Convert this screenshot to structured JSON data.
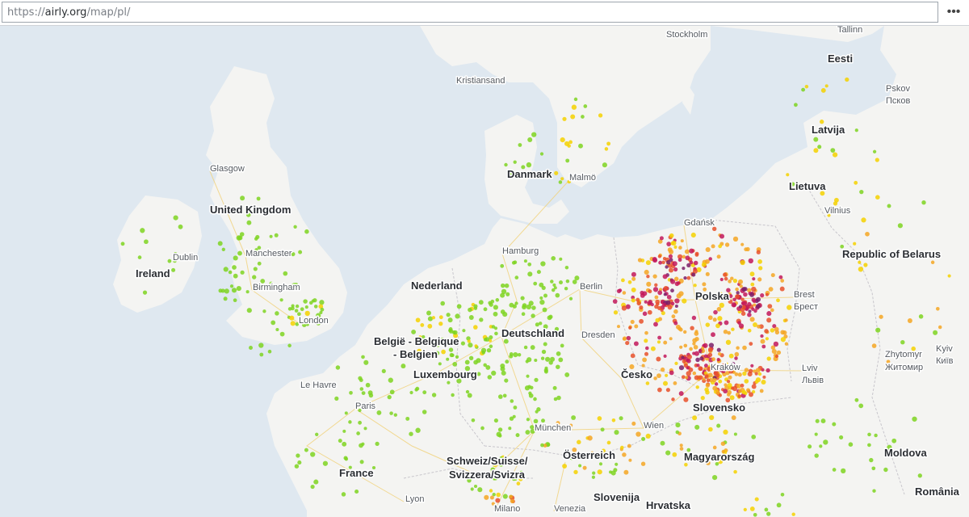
{
  "browser": {
    "url_prefix": "https://",
    "url_host": "airly.org",
    "url_path": "/map/pl/",
    "menu_icon": "more-horizontal-icon",
    "menu_glyph": "•••"
  },
  "map": {
    "colors": {
      "water": "#dfe8f0",
      "land": "#f4f4f2",
      "land_alt": "#f7f7f5",
      "borders": "#c8c6cc",
      "roads": "#f1d27a",
      "sensor_good": "#7ed321",
      "sensor_moderate": "#f5d100",
      "sensor_poor": "#f5a623",
      "sensor_bad": "#e8502a",
      "sensor_very_bad": "#c2185b",
      "sensor_extreme": "#7b1f6a"
    },
    "countries": [
      "Eesti",
      "Latvija",
      "Lietuva",
      "Danmark",
      "United Kingdom",
      "Ireland",
      "Nederland",
      "België - Belgique",
      "- Belgien",
      "Luxembourg",
      "Deutschland",
      "Polska",
      "Republic of Belarus",
      "Česko",
      "Slovensko",
      "Österreich",
      "Schweiz/Suisse/",
      "Svizzera/Svizra",
      "Magyarország",
      "France",
      "Slovenija",
      "Hrvatska",
      "Moldova",
      "România"
    ],
    "cities": [
      "Stockholm",
      "Tallinn",
      "Kristiansand",
      "Pskov",
      "Псков",
      "Malmö",
      "Glasgow",
      "Gdańsk",
      "Vilnius",
      "Dublin",
      "Manchester",
      "Hamburg",
      "Birmingham",
      "Berlin",
      "Brest",
      "Брест",
      "London",
      "Dresden",
      "Zhytomyr",
      "Житомир",
      "Kyiv",
      "Київ",
      "Kraków",
      "Lviv",
      "Львів",
      "Le Havre",
      "Paris",
      "Wien",
      "München",
      "Lyon",
      "Milano",
      "Venezia"
    ]
  }
}
